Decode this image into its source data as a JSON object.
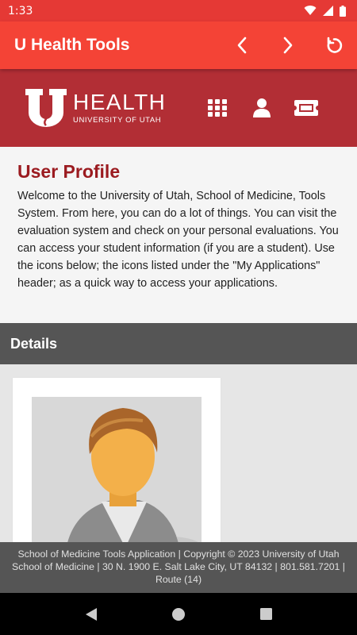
{
  "status_bar": {
    "time": "1:33"
  },
  "app_bar": {
    "title": "U Health Tools",
    "back_icon": "chevron-left-icon",
    "forward_icon": "chevron-right-icon",
    "refresh_icon": "refresh-icon"
  },
  "brand": {
    "logo_letter": "U",
    "logo_health": "HEALTH",
    "logo_sub": "UNIVERSITY OF UTAH",
    "icons": [
      "grid-icon",
      "person-icon",
      "ticket-icon"
    ]
  },
  "intro": {
    "title": "User Profile",
    "body": "Welcome to the University of Utah, School of Medicine, Tools System. From here, you can do a lot of things. You can visit the evaluation system and check on your personal evaluations. You can access your student information (if you are a student). Use the icons below; the icons listed under the \"My Applications\" header; as a quick way to access your applications."
  },
  "details": {
    "title": "Details"
  },
  "footer": {
    "text": "School of Medicine Tools Application | Copyright © 2023 University of Utah School of Medicine | 30 N. 1900 E. Salt Lake City, UT 84132 | 801.581.7201 | Route (14)"
  },
  "colors": {
    "status_bar": "#e53935",
    "app_bar": "#f44336",
    "brand_header": "#b22e35",
    "title_red": "#9b1b20",
    "details_bar": "#555555"
  }
}
